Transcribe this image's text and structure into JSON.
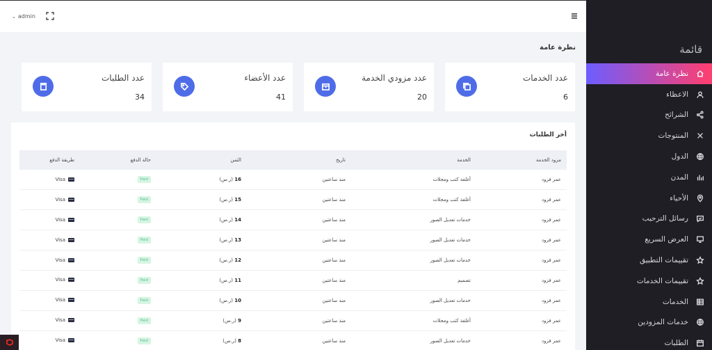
{
  "topbar": {
    "user_label": "admin"
  },
  "sidebar": {
    "title": "قائمة",
    "items": [
      {
        "label": "نظرة عامة",
        "icon": "home-icon",
        "active": true
      },
      {
        "label": "الاعظاء",
        "icon": "user-icon"
      },
      {
        "label": "الشرائح",
        "icon": "share-icon"
      },
      {
        "label": "المنتوجات",
        "icon": "x-icon"
      },
      {
        "label": "الدول",
        "icon": "globe-icon"
      },
      {
        "label": "المدن",
        "icon": "bar-chart-icon"
      },
      {
        "label": "الأحياء",
        "icon": "map-pin-icon"
      },
      {
        "label": "رسائل الترحيب",
        "icon": "message-icon"
      },
      {
        "label": "العرض السريع",
        "icon": "monitor-icon"
      },
      {
        "label": "تقييمات التطبيق",
        "icon": "star-icon"
      },
      {
        "label": "تقييمات الخدمات",
        "icon": "star-icon"
      },
      {
        "label": "الخدمات",
        "icon": "grid-icon"
      },
      {
        "label": "خدمات المزودين",
        "icon": "globe-icon"
      },
      {
        "label": "الطلبات",
        "icon": "calendar-icon"
      }
    ]
  },
  "main": {
    "heading": "نظرة عامة",
    "cards": [
      {
        "label": "عدد الخدمات",
        "value": "6",
        "icon": "copy-icon"
      },
      {
        "label": "عدد مزودي الخدمة",
        "value": "20",
        "icon": "archive-icon"
      },
      {
        "label": "عدد الأعضاء",
        "value": "41",
        "icon": "tag-icon"
      },
      {
        "label": "عدد الطلبات",
        "value": "34",
        "icon": "clipboard-icon"
      }
    ],
    "orders": {
      "title": "أخر الطلبات",
      "columns": [
        "مزود الخدمة",
        "الخدمة",
        "تاريخ",
        "الثمن",
        "حالة الدفع",
        "طريقة الدفع"
      ],
      "rows": [
        {
          "provider": "عمر فزود",
          "service": "أغلفة كتب ومجلات",
          "date": "منذ ساعتين",
          "price": "16",
          "currency": "(ر.س)",
          "status": "Paid",
          "method": "Visa"
        },
        {
          "provider": "عمر فزود",
          "service": "أغلفة كتب ومجلات",
          "date": "منذ ساعتين",
          "price": "15",
          "currency": "(ر.س)",
          "status": "Paid",
          "method": "Visa"
        },
        {
          "provider": "عمر فزود",
          "service": "خدمات تعديل الصور",
          "date": "منذ ساعتين",
          "price": "14",
          "currency": "(ر.س)",
          "status": "Paid",
          "method": "Visa"
        },
        {
          "provider": "عمر فزود",
          "service": "خدمات تعديل الصور",
          "date": "منذ ساعتين",
          "price": "13",
          "currency": "(ر.س)",
          "status": "Paid",
          "method": "Visa"
        },
        {
          "provider": "عمر فزود",
          "service": "خدمات تعديل الصور",
          "date": "منذ ساعتين",
          "price": "12",
          "currency": "(ر.س)",
          "status": "Paid",
          "method": "Visa"
        },
        {
          "provider": "عمر فزود",
          "service": "تصميم",
          "date": "منذ ساعتين",
          "price": "11",
          "currency": "(ر.س)",
          "status": "Paid",
          "method": "Visa"
        },
        {
          "provider": "عمر فزود",
          "service": "خدمات تعديل الصور",
          "date": "منذ ساعتين",
          "price": "10",
          "currency": "(ر.س)",
          "status": "Paid",
          "method": "Visa"
        },
        {
          "provider": "عمر فزود",
          "service": "أغلفة كتب ومجلات",
          "date": "منذ ساعتين",
          "price": "9",
          "currency": "(ر.س)",
          "status": "Paid",
          "method": "Visa"
        },
        {
          "provider": "عمر فزود",
          "service": "خدمات تعديل الصور",
          "date": "منذ ساعتين",
          "price": "8",
          "currency": "(ر.س)",
          "status": "Paid",
          "method": "Visa"
        }
      ]
    }
  },
  "colors": {
    "sidebar_bg": "#1e1e24",
    "active_gradient_start": "#ff3f6e",
    "active_gradient_end": "#6d5dff",
    "card_icon": "#4f6ce8",
    "paid_badge": "#d6f5e4"
  }
}
